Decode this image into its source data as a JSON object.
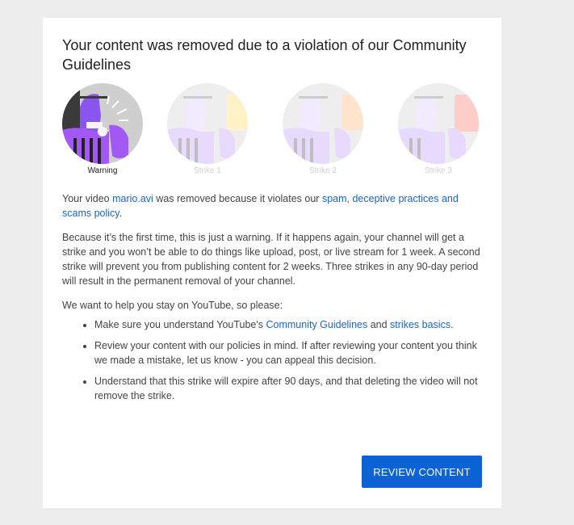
{
  "dialog": {
    "title": "Your content was removed due to a violation of our Community Guidelines",
    "strikes": [
      {
        "label": "Warning",
        "active": true
      },
      {
        "label": "Strike 1",
        "active": false
      },
      {
        "label": "Strike 2",
        "active": false
      },
      {
        "label": "Strike 3",
        "active": false
      }
    ],
    "para1": {
      "prefix": "Your video ",
      "video_link": "mario.avi",
      "middle": " was removed because it violates our ",
      "policy_link": "spam, deceptive practices and scams policy",
      "suffix": "."
    },
    "para2": "Because it’s the first time, this is just a warning. If it happens again, your channel will get a strike and you won’t be able to do things like upload, post, or live stream for 1 week. A second strike will prevent you from publishing content for 2 weeks. Three strikes in any 90-day period will result in the permanent removal of your channel.",
    "para3": "We want to help you stay on YouTube, so please:",
    "bullet1": {
      "prefix": "Make sure you understand YouTube's ",
      "guidelines_link": "Community Guidelines",
      "middle": " and ",
      "strikes_link": "strikes basics",
      "suffix": "."
    },
    "bullet2": "Review your content with our policies in mind. If after reviewing your content you think we made a mistake, let us know - you can appeal this decision.",
    "bullet3": "Understand that this strike will expire after 90 days, and that deleting the video will not remove the strike.",
    "review_button": "REVIEW CONTENT"
  },
  "colors": {
    "link": "#1a64c8",
    "button": "#0b63d6",
    "illustration_purple": "#a259f4",
    "card_yellow": "#ffe27a",
    "card_orange": "#ffc08a",
    "card_red": "#ff8a80"
  }
}
